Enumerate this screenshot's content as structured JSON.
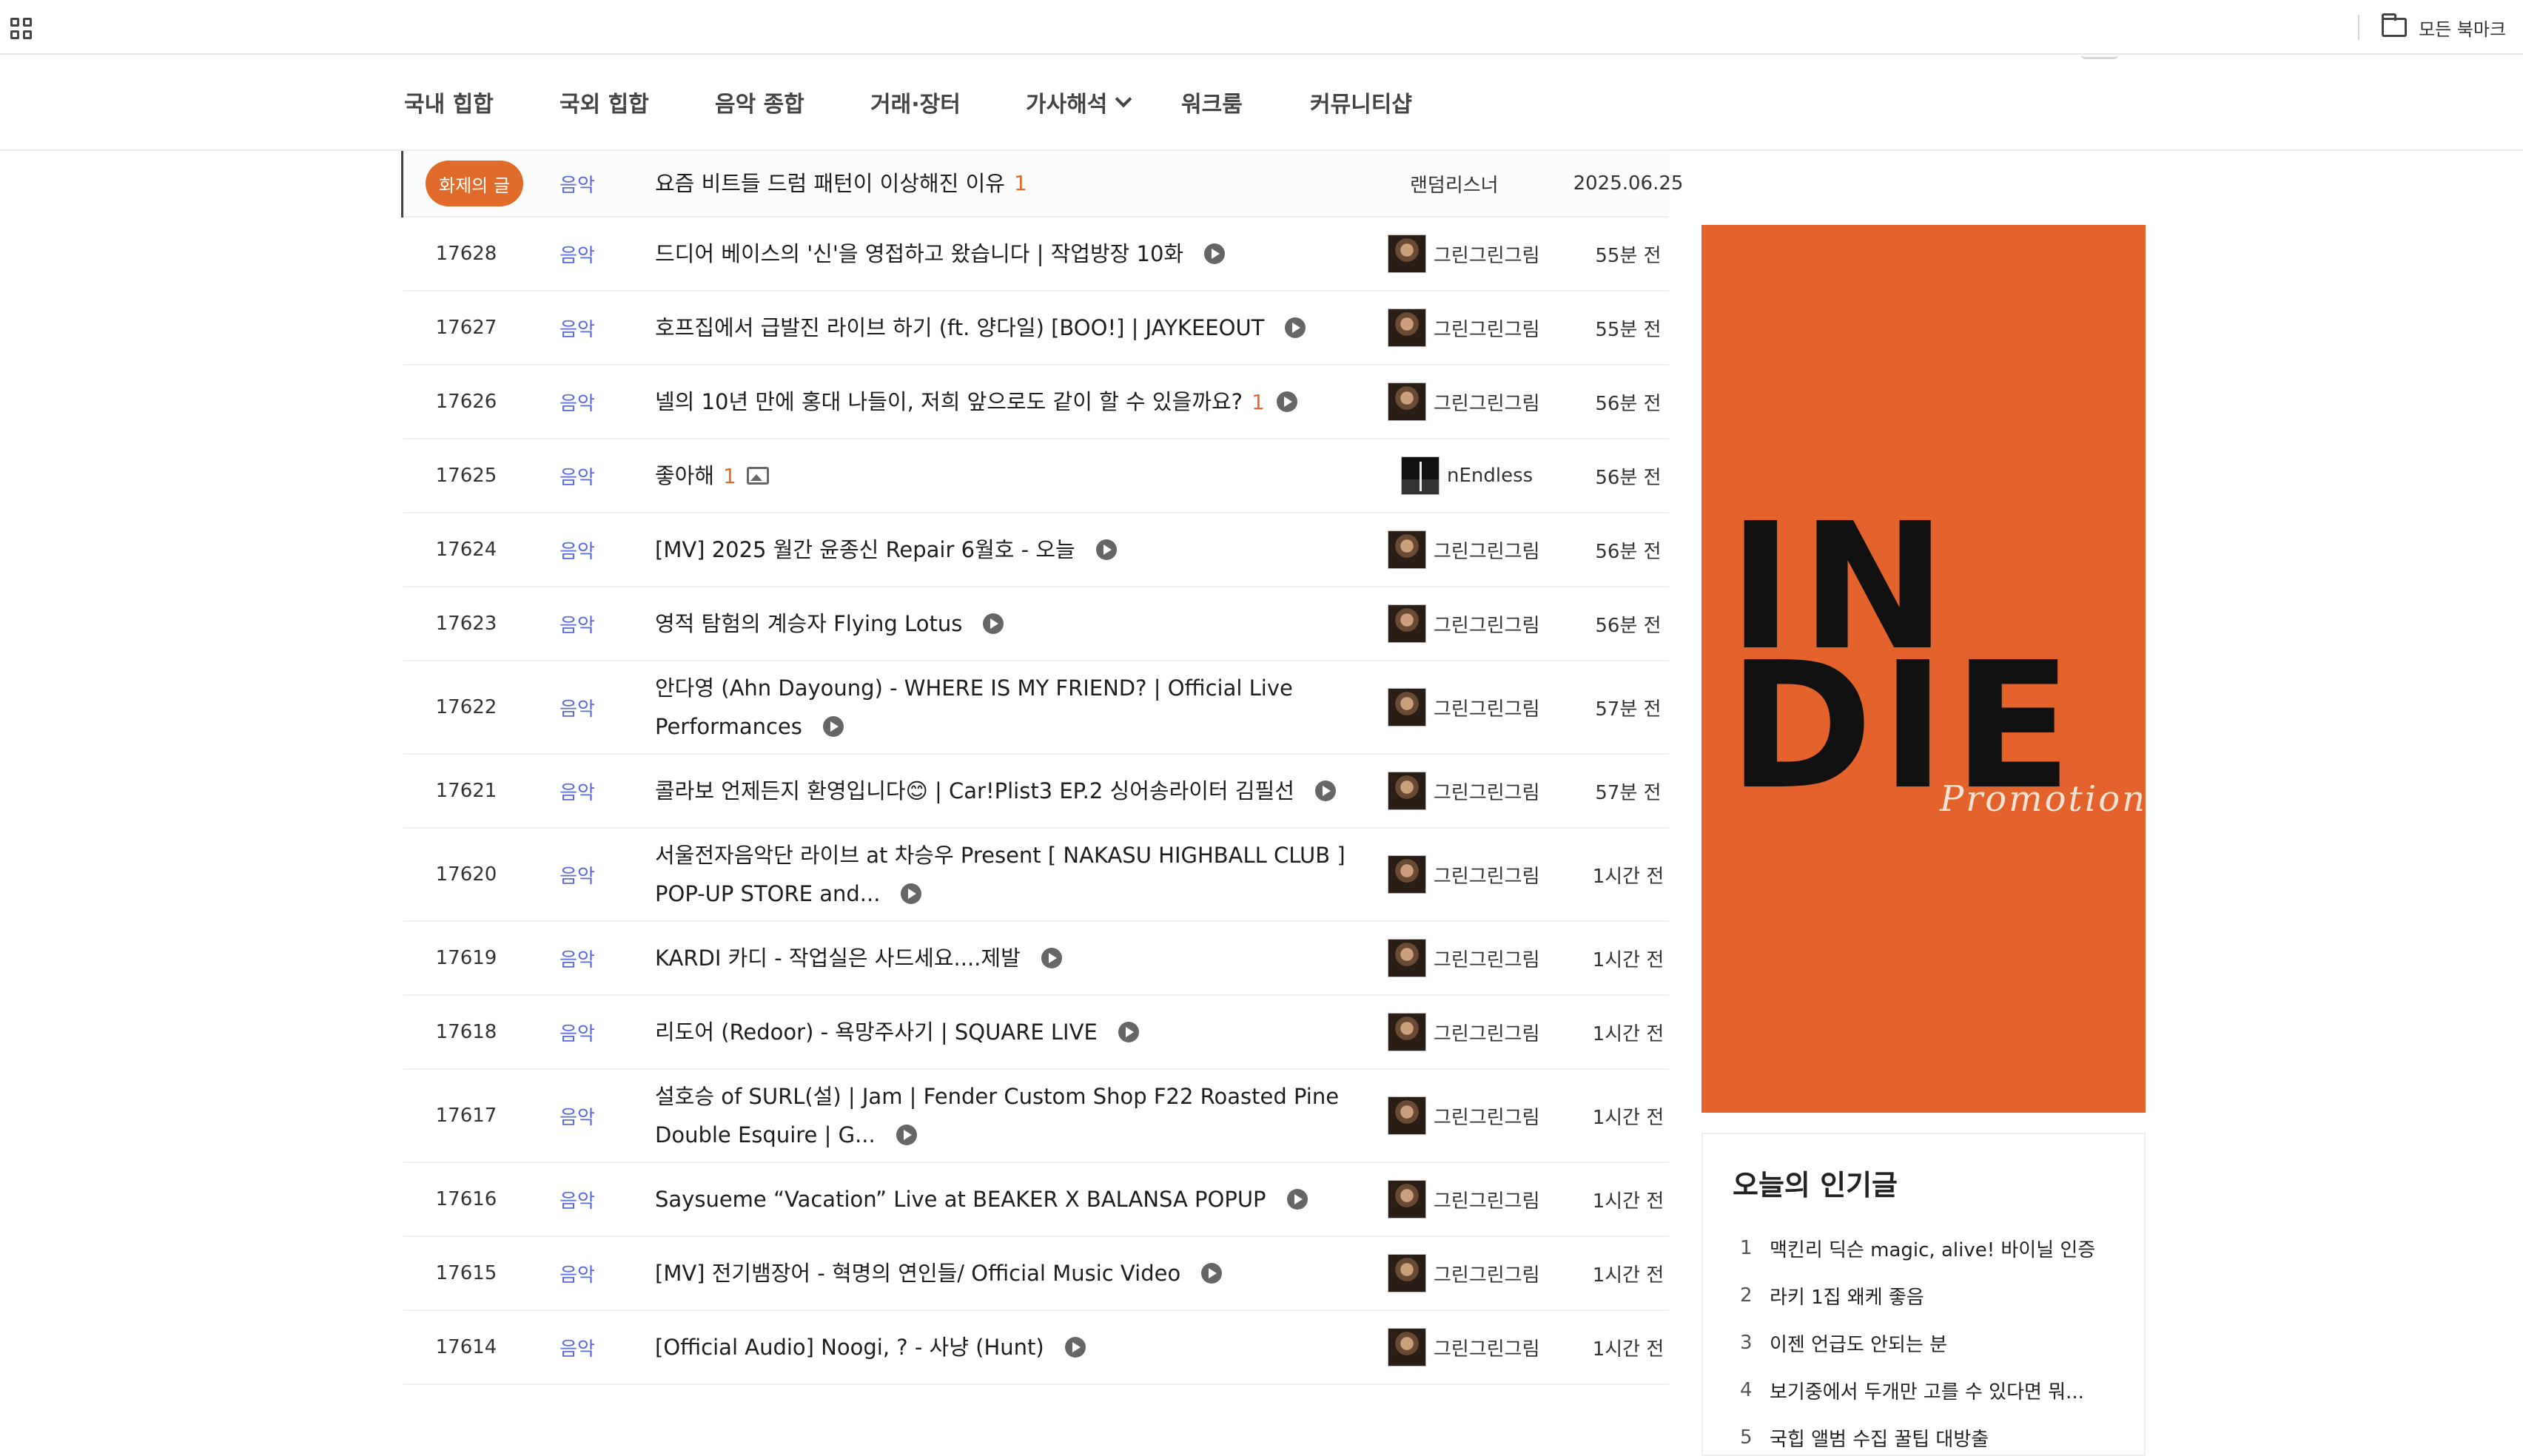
{
  "bookmark_bar": {
    "all_bookmarks_label": "모든 북마크"
  },
  "nav": {
    "items": [
      {
        "label": "국내 힙합"
      },
      {
        "label": "국외 힙합"
      },
      {
        "label": "음악 종합"
      },
      {
        "label": "거래·장터"
      },
      {
        "label": "가사해석"
      },
      {
        "label": "워크룸"
      },
      {
        "label": "커뮤니티샵"
      }
    ]
  },
  "pinned": {
    "badge": "화제의 글",
    "category": "음악",
    "title": "요즘 비트들 드럼 패턴이 이상해진 이유",
    "comments": "1",
    "author": "랜덤리스너",
    "date": "2025.06.25"
  },
  "posts": [
    {
      "num": "17628",
      "category": "음악",
      "title": "드디어 베이스의 '신'을 영접하고 왔습니다 | 작업방장 10화",
      "comments": "",
      "author": "그린그린그림",
      "time": "55분 전"
    },
    {
      "num": "17627",
      "category": "음악",
      "title": "호프집에서 급발진 라이브 하기 (ft. 양다일) [BOO!] | JAYKEEOUT",
      "comments": "",
      "author": "그린그린그림",
      "time": "55분 전"
    },
    {
      "num": "17626",
      "category": "음악",
      "title": "넬의 10년 만에 홍대 나들이, 저희 앞으로도 같이 할 수 있을까요?",
      "comments": "1",
      "author": "그린그린그림",
      "time": "56분 전"
    },
    {
      "num": "17625",
      "category": "음악",
      "title": "좋아해",
      "comments": "1",
      "author": "nEndless",
      "time": "56분 전"
    },
    {
      "num": "17624",
      "category": "음악",
      "title": "[MV] 2025 월간 윤종신 Repair 6월호 - 오늘",
      "comments": "",
      "author": "그린그린그림",
      "time": "56분 전"
    },
    {
      "num": "17623",
      "category": "음악",
      "title": "영적 탐험의 계승자 Flying Lotus",
      "comments": "",
      "author": "그린그린그림",
      "time": "56분 전"
    },
    {
      "num": "17622",
      "category": "음악",
      "title": "안다영 (Ahn Dayoung) - WHERE IS MY FRIEND? | Official Live Performances",
      "comments": "",
      "author": "그린그린그림",
      "time": "57분 전"
    },
    {
      "num": "17621",
      "category": "음악",
      "title": "콜라보 언제든지 환영입니다😊 | Car!Plist3 EP.2 싱어송라이터 김필선",
      "comments": "",
      "author": "그린그린그림",
      "time": "57분 전"
    },
    {
      "num": "17620",
      "category": "음악",
      "title": "서울전자음악단 라이브 at 차승우 Present [ NAKASU HIGHBALL CLUB ] POP-UP STORE and...",
      "comments": "",
      "author": "그린그린그림",
      "time": "1시간 전"
    },
    {
      "num": "17619",
      "category": "음악",
      "title": "KARDI 카디 - 작업실은 사드세요....제발",
      "comments": "",
      "author": "그린그린그림",
      "time": "1시간 전"
    },
    {
      "num": "17618",
      "category": "음악",
      "title": "리도어 (Redoor) - 욕망주사기 | SQUARE LIVE",
      "comments": "",
      "author": "그린그린그림",
      "time": "1시간 전"
    },
    {
      "num": "17617",
      "category": "음악",
      "title": "설호승 of SURL(설) | Jam | Fender Custom Shop F22 Roasted Pine Double Esquire | G...",
      "comments": "",
      "author": "그린그린그림",
      "time": "1시간 전"
    },
    {
      "num": "17616",
      "category": "음악",
      "title": "Saysueme “Vacation” Live at BEAKER X BALANSA POPUP",
      "comments": "",
      "author": "그린그린그림",
      "time": "1시간 전"
    },
    {
      "num": "17615",
      "category": "음악",
      "title": "[MV] 전기뱀장어 - 혁명의 연인들/ Official Music Video",
      "comments": "",
      "author": "그린그린그림",
      "time": "1시간 전"
    },
    {
      "num": "17614",
      "category": "음악",
      "title": "[Official Audio] Noogi, ? - 사냥 (Hunt)",
      "comments": "",
      "author": "그린그린그림",
      "time": "1시간 전"
    }
  ],
  "sidebar": {
    "banner": {
      "line1": "IN",
      "line2": "DIE",
      "script": "Promotion",
      "bg_color": "#e4622b"
    },
    "popular": {
      "title": "오늘의 인기글",
      "items": [
        {
          "rank": "1",
          "title": "맥킨리 딕슨 magic, alive! 바이닐 인증"
        },
        {
          "rank": "2",
          "title": "라키 1집 왜케 좋음"
        },
        {
          "rank": "3",
          "title": "이젠 언급도 안되는 분"
        },
        {
          "rank": "4",
          "title": "보기중에서 두개만 고를 수 있다면 뭐..."
        },
        {
          "rank": "5",
          "title": "국힙 앨범 수집 꿀팁 대방출"
        }
      ]
    }
  },
  "colors": {
    "accent": "#e06b2a",
    "category": "#5b6bdc"
  }
}
